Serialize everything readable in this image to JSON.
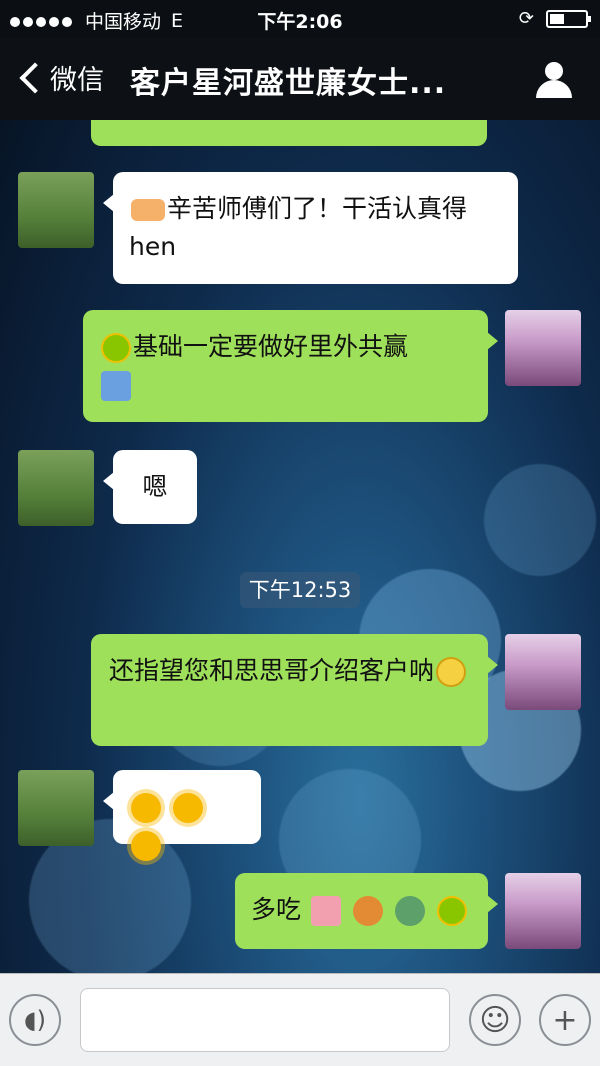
{
  "status_bar": {
    "carrier": "中国移动",
    "network": "E",
    "time": "下午2:06"
  },
  "nav": {
    "back_label": "微信",
    "title": "客户星河盛世廉女士..."
  },
  "messages": [
    {
      "side": "right",
      "text": ""
    },
    {
      "side": "left",
      "text": "辛苦师傅们了！干活认真得hen"
    },
    {
      "side": "right",
      "text": "基础一定要做好里外共赢"
    },
    {
      "side": "left",
      "text": "嗯"
    },
    {
      "side": "right",
      "text": "还指望您和思思哥介绍客户呐"
    },
    {
      "side": "left",
      "text": ""
    },
    {
      "side": "right",
      "text": "多吃"
    }
  ],
  "timestamp": "下午12:53",
  "colors": {
    "green_bubble": "#9fe05b",
    "white_bubble": "#ffffff",
    "nav_bg": "#0d1116"
  }
}
